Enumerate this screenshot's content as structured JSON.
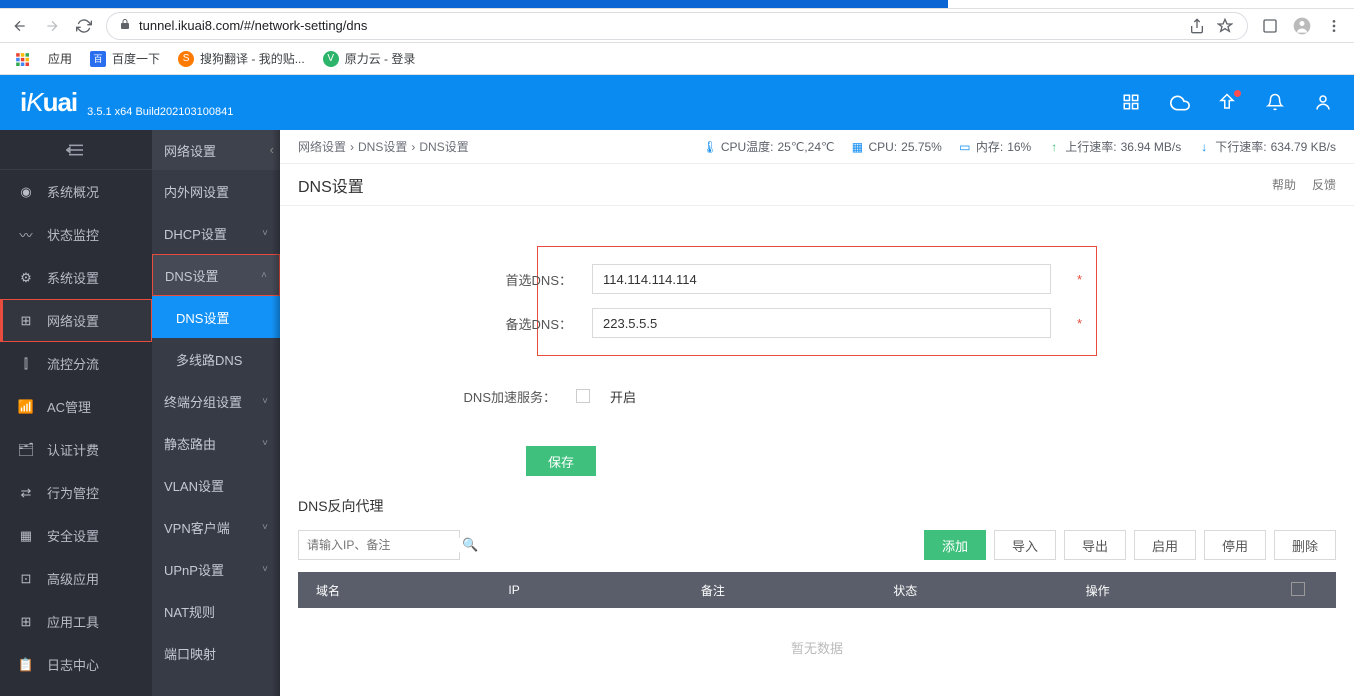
{
  "browser": {
    "url": "tunnel.ikuai8.com/#/network-setting/dns",
    "bookmarks_label": "应用",
    "bookmarks": [
      {
        "icon": "baidu",
        "label": "百度一下"
      },
      {
        "icon": "sogou",
        "label": "搜狗翻译 - 我的贴..."
      },
      {
        "icon": "cloud",
        "label": "原力云 - 登录"
      }
    ]
  },
  "header": {
    "logo": "iKuai",
    "version": "3.5.1 x64 Build202103100841"
  },
  "nav1": [
    {
      "icon": "dash",
      "label": "系统概况"
    },
    {
      "icon": "monitor",
      "label": "状态监控"
    },
    {
      "icon": "gear",
      "label": "系统设置"
    },
    {
      "icon": "net",
      "label": "网络设置",
      "active": true
    },
    {
      "icon": "flow",
      "label": "流控分流"
    },
    {
      "icon": "ac",
      "label": "AC管理"
    },
    {
      "icon": "auth",
      "label": "认证计费"
    },
    {
      "icon": "behav",
      "label": "行为管控"
    },
    {
      "icon": "sec",
      "label": "安全设置"
    },
    {
      "icon": "adv",
      "label": "高级应用"
    },
    {
      "icon": "tool",
      "label": "应用工具"
    },
    {
      "icon": "log",
      "label": "日志中心"
    }
  ],
  "nav2": {
    "header": "网络设置",
    "items": [
      {
        "label": "内外网设置",
        "expand": false
      },
      {
        "label": "DHCP设置",
        "expand": true
      },
      {
        "label": "DNS设置",
        "expand": true,
        "hi": true,
        "open": true
      },
      {
        "label": "终端分组设置",
        "expand": true
      },
      {
        "label": "静态路由",
        "expand": true
      },
      {
        "label": "VLAN设置",
        "expand": false
      },
      {
        "label": "VPN客户端",
        "expand": true
      },
      {
        "label": "UPnP设置",
        "expand": true
      },
      {
        "label": "NAT规则",
        "expand": false
      },
      {
        "label": "端口映射",
        "expand": false
      }
    ],
    "subs": [
      {
        "label": "DNS设置",
        "active": true
      },
      {
        "label": "多线路DNS",
        "active": false
      }
    ]
  },
  "breadcrumb": [
    "网络设置",
    "DNS设置",
    "DNS设置"
  ],
  "stats": {
    "cpu_temp_label": "CPU温度:",
    "cpu_temp": "25℃,24℃",
    "cpu_label": "CPU:",
    "cpu": "25.75%",
    "mem_label": "内存:",
    "mem": "16%",
    "up_label": "上行速率:",
    "up": "36.94 MB/s",
    "down_label": "下行速率:",
    "down": "634.79 KB/s"
  },
  "page": {
    "title": "DNS设置",
    "help": "帮助",
    "feedback": "反馈",
    "primary_label": "首选DNS：",
    "primary": "114.114.114.114",
    "secondary_label": "备选DNS：",
    "secondary": "223.5.5.5",
    "accel_label": "DNS加速服务：",
    "accel_opt": "开启",
    "save": "保存",
    "section2": "DNS反向代理",
    "search_placeholder": "请输入IP、备注",
    "btn_add": "添加",
    "btn_import": "导入",
    "btn_export": "导出",
    "btn_enable": "启用",
    "btn_disable": "停用",
    "btn_delete": "删除",
    "cols": [
      "域名",
      "IP",
      "备注",
      "状态",
      "操作"
    ],
    "empty": "暂无数据"
  }
}
